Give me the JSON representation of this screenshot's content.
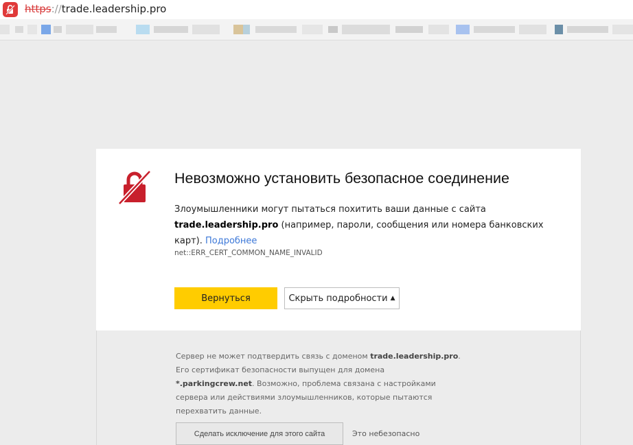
{
  "browser": {
    "address": {
      "scheme": "https",
      "separator": "://",
      "host": "trade.leadership.pro"
    },
    "security_icon": "insecure-lock-icon"
  },
  "error": {
    "icon": "broken-lock-icon",
    "title": "Невозможно установить безопасное соединение",
    "desc_before": "Злоумышленники могут пытаться похитить ваши данные с сайта ",
    "domain": "trade.leadership.pro",
    "desc_after": " (например, пароли, сообщения или номера банковских карт). ",
    "more_link": "Подробнее",
    "code": "net::ERR_CERT_COMMON_NAME_INVALID",
    "back_button": "Вернуться",
    "hide_details_button": "Скрыть подробности",
    "hide_arrow": "▲"
  },
  "details": {
    "text_1": "Сервер не может подтвердить связь с доменом ",
    "domain": "trade.leadership.pro",
    "text_2": ". Его сертификат безопасности выпущен для домена ",
    "cert_domain": "*.parkingcrew.net",
    "text_3": ". Возможно, проблема связана с настройками сервера или действиями злоумышленников, которые пытаются перехватить данные.",
    "exception_button": "Сделать исключение для этого сайта",
    "unsafe_note": "Это небезопасно"
  },
  "colors": {
    "accent_yellow": "#ffcc00",
    "danger_red": "#c8202c",
    "link_blue": "#3c78d8"
  }
}
